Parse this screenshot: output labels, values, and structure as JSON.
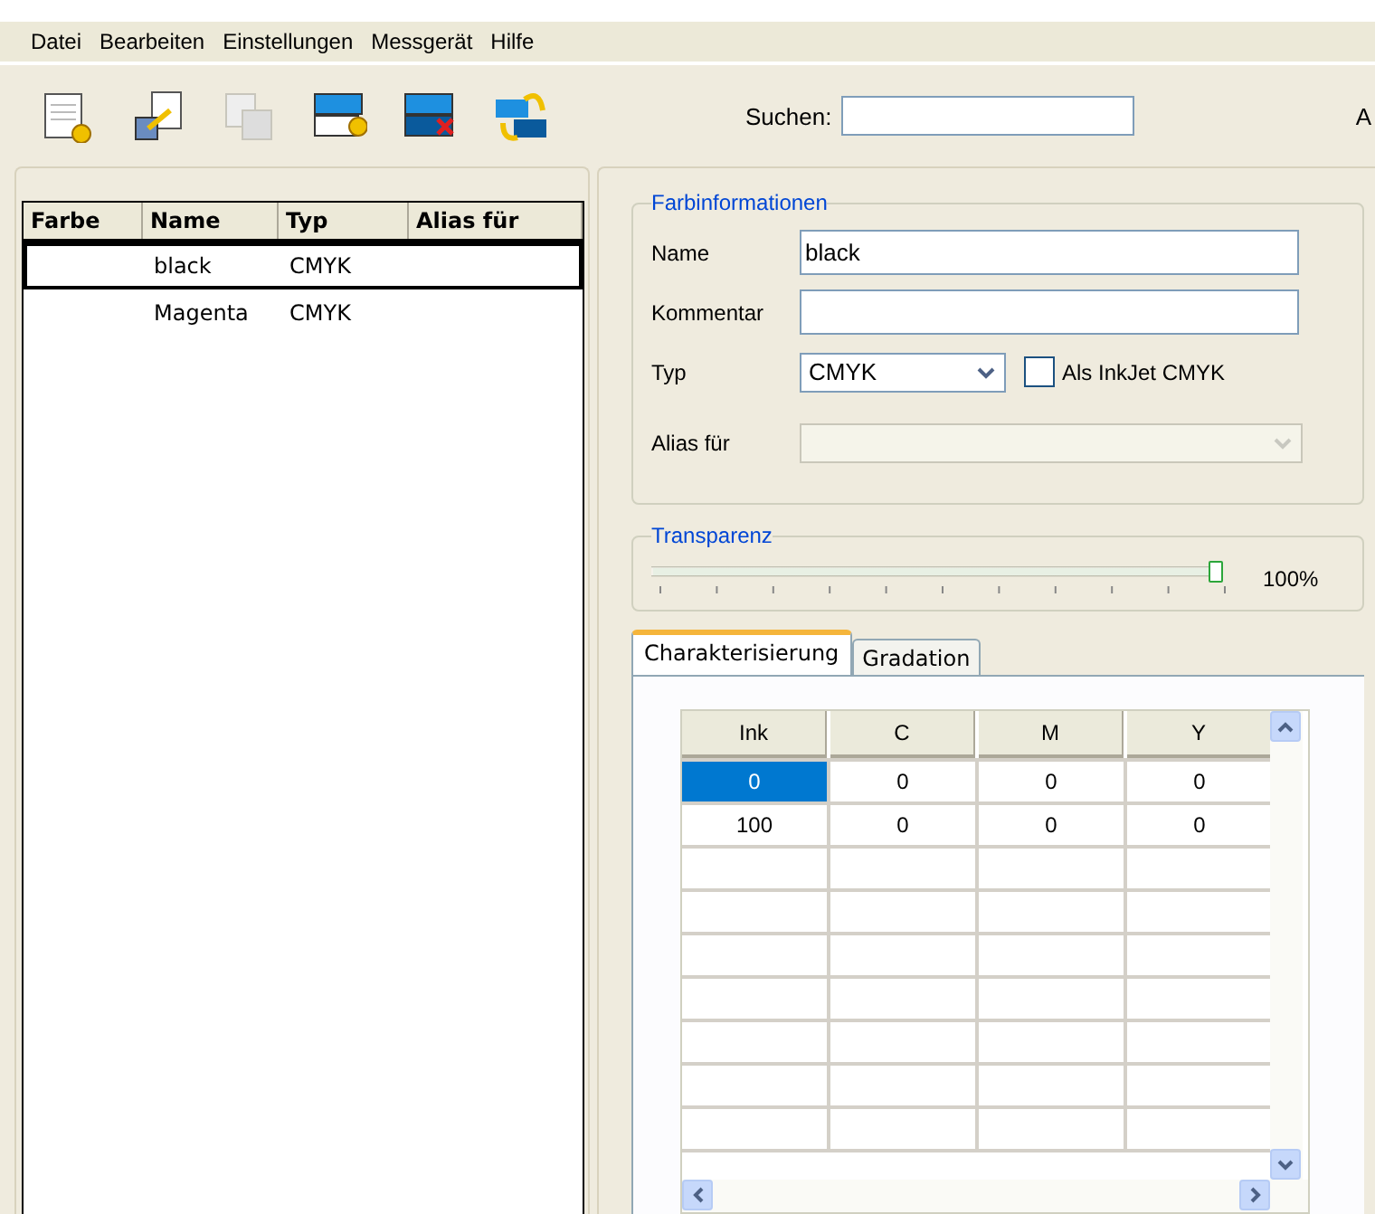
{
  "menu": [
    {
      "label": "Datei"
    },
    {
      "label": "Bearbeiten"
    },
    {
      "label": "Einstellungen"
    },
    {
      "label": "Messgerät"
    },
    {
      "label": "Hilfe"
    }
  ],
  "toolbar": [
    {
      "kind": "new",
      "disabled": false
    },
    {
      "kind": "import",
      "disabled": false
    },
    {
      "kind": "copy",
      "disabled": true
    },
    {
      "kind": "add",
      "disabled": false
    },
    {
      "kind": "delete",
      "disabled": false
    },
    {
      "kind": "swap",
      "disabled": false
    }
  ],
  "search": {
    "label": "Suchen:"
  },
  "cut_label": "A",
  "color_table": {
    "columns": [
      "Farbe",
      "Name",
      "Typ",
      "Alias für"
    ],
    "rows": [
      {
        "name": "black",
        "type": "CMYK",
        "selected": true
      },
      {
        "name": "Magenta",
        "type": "CMYK",
        "selected": false
      }
    ]
  },
  "color_info": {
    "title": "Farbinformationen",
    "name_label": "Name",
    "name_value": "black",
    "comment_label": "Kommentar",
    "type_label": "Typ",
    "type_value": "CMYK",
    "inkjet_label": "Als InkJet CMYK",
    "inkjet_checked": false,
    "alias_label": "Alias für",
    "alias_disabled": true
  },
  "transparency": {
    "title": "Transparenz",
    "level": 1.0,
    "reading": "100%"
  },
  "tabs": [
    {
      "label": "Charakterisierung",
      "selected": true
    },
    {
      "label": "Gradation",
      "selected": false
    }
  ],
  "grid": {
    "columns": [
      "Ink",
      "C",
      "M",
      "Y"
    ],
    "rows": [
      {
        "cells": [
          "0",
          "0",
          "0",
          "0"
        ],
        "selected": true
      },
      {
        "cells": [
          "100",
          "0",
          "0",
          "0"
        ],
        "selected": false
      }
    ]
  }
}
